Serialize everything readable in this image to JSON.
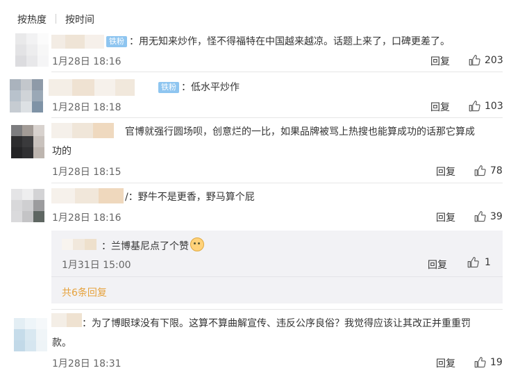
{
  "tabs": {
    "hot": "按热度",
    "time": "按时间"
  },
  "reply_label": "回复",
  "badge_label": "铁粉",
  "comments": [
    {
      "sep": "：",
      "text": "用无知来炒作，怪不得福特在中国越来越凉。话题上来了，口碑更差了。",
      "time": "1月28日 18:16",
      "likes": "203"
    },
    {
      "sep": "：",
      "text": "低水平炒作",
      "time": "1月28日 18:18",
      "likes": "103"
    },
    {
      "line1": "官博就强行圆场呗，创意烂的一比，如果品牌被骂上热搜也能算成功的话那它算成",
      "line2": "功的",
      "time": "1月28日 18:15",
      "likes": "78"
    },
    {
      "sep": "/：",
      "text": "野牛不是更香，野马算个屁",
      "time": "1月28日 18:16",
      "likes": "39"
    },
    {
      "sep": "：",
      "line1": "为了博眼球没有下限。这算不算曲解宣传、违反公序良俗？我觉得应该让其改正并重重罚",
      "line2": "款。",
      "time": "1月28日 18:31",
      "likes": "19"
    }
  ],
  "sub_reply": {
    "sep": "：",
    "text": "兰博基尼点了个赞",
    "time": "1月31日 15:00",
    "likes": "1"
  },
  "more_replies": "共6条回复",
  "colors": {
    "badge": "#8ec5f0",
    "more_link": "#e6a23c",
    "reply_box": "#f2f2f5"
  }
}
